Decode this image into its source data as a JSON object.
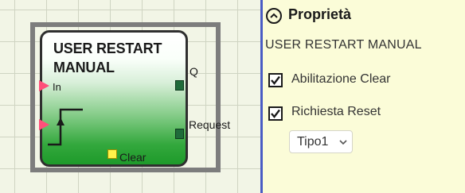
{
  "block": {
    "title": "USER RESTART MANUAL",
    "inputs": {
      "in": "In"
    },
    "outputs": {
      "q": "Q",
      "request": "Request"
    },
    "bottom_pin": "Clear",
    "icon": "rising-edge-icon"
  },
  "properties": {
    "title": "Proprietà",
    "subtitle": "USER RESTART MANUAL",
    "options": [
      {
        "label": "Abilitazione Clear",
        "checked": true
      },
      {
        "label": "Richiesta Reset",
        "checked": true
      }
    ],
    "type_select": {
      "value": "Tipo1",
      "icon": "chevron-down-icon"
    },
    "collapse_icon": "chevron-up-circle-icon"
  },
  "colors": {
    "input_pin": "#ff4f7a",
    "output_pin": "#1f6b3a",
    "clear_pin": "#fff34a",
    "block_gradient_bottom": "#1e9a2a",
    "panel_bg": "#fbfcd8",
    "splitter": "#4a5cc4"
  }
}
